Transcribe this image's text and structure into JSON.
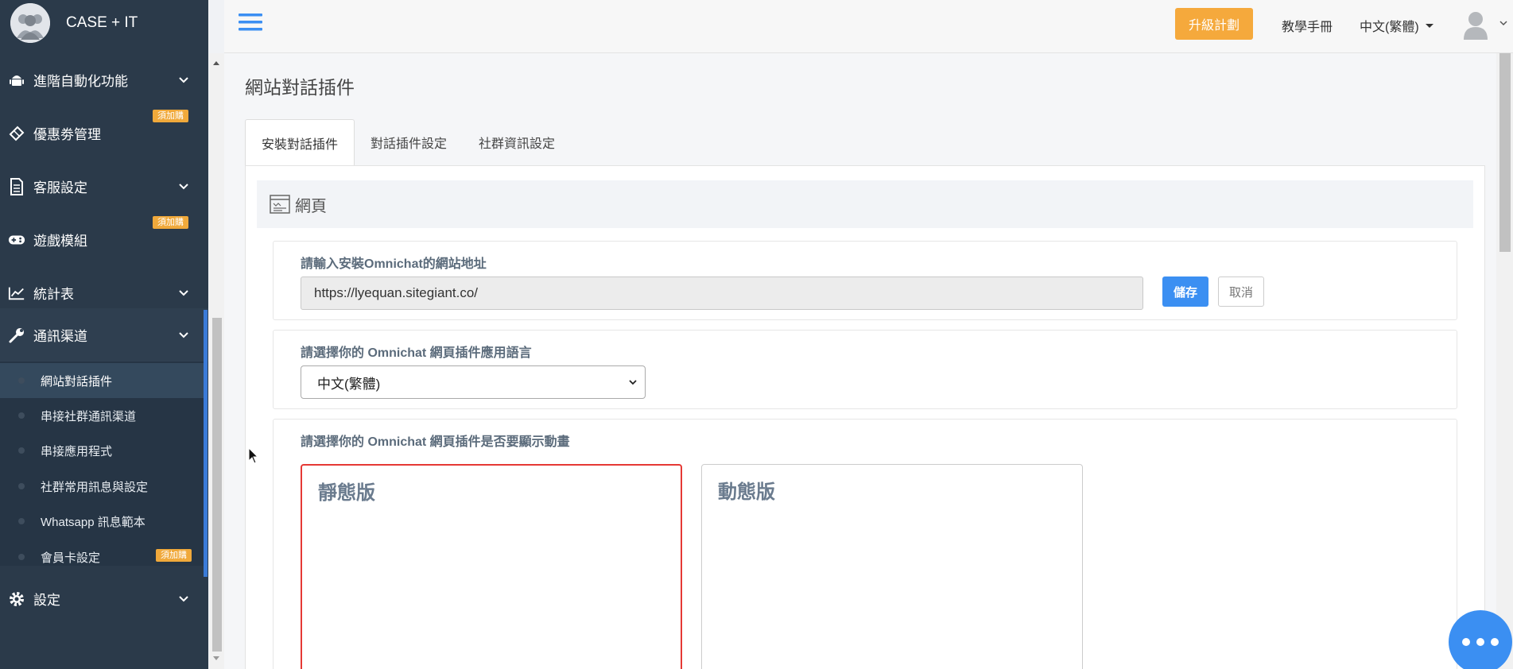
{
  "brand": "CASE + IT",
  "topbar": {
    "upgrade_label": "升級計劃",
    "manual_label": "教學手冊",
    "language_label": "中文(繁體)"
  },
  "sidebar": {
    "items": [
      {
        "label": "進階自動化功能",
        "icon": "android-icon",
        "chevron": true
      },
      {
        "label": "優惠劵管理",
        "icon": "ticket-icon",
        "badge": "須加購"
      },
      {
        "label": "客服設定",
        "icon": "document-icon",
        "chevron": true
      },
      {
        "label": "遊戲模組",
        "icon": "gamepad-icon",
        "badge": "須加購"
      },
      {
        "label": "統計表",
        "icon": "line-chart-icon",
        "chevron": true
      },
      {
        "label": "通訊渠道",
        "icon": "wrench-icon",
        "chevron": true
      },
      {
        "label": "設定",
        "icon": "gear-icon",
        "chevron": true
      }
    ],
    "sub_items": [
      {
        "label": "網站對話插件",
        "active": true
      },
      {
        "label": "串接社群通訊渠道"
      },
      {
        "label": "串接應用程式"
      },
      {
        "label": "社群常用訊息與設定"
      },
      {
        "label": "Whatsapp 訊息範本"
      },
      {
        "label": "會員卡設定",
        "badge": "須加購"
      }
    ]
  },
  "main": {
    "page_title": "網站對話插件",
    "tabs": [
      {
        "label": "安裝對話插件",
        "active": true
      },
      {
        "label": "對話插件設定"
      },
      {
        "label": "社群資訊設定"
      }
    ],
    "card_title": "網頁",
    "url_section": {
      "label": "請輸入安裝Omnichat的網站地址",
      "value": "https://lyequan.sitegiant.co/",
      "save_label": "儲存",
      "cancel_label": "取消"
    },
    "language_section": {
      "label": "請選擇你的 Omnichat 網頁插件應用語言",
      "selected": "中文(繁體)"
    },
    "animation_section": {
      "label": "請選擇你的 Omnichat 網頁插件是否要顯示動畫",
      "options": [
        {
          "label": "靜態版",
          "selected": true
        },
        {
          "label": "動態版",
          "selected": false
        }
      ]
    }
  },
  "colors": {
    "sidebar_bg": "#2b3a4a",
    "accent_blue": "#3b8ff2",
    "upgrade_orange": "#f5a93c",
    "selected_red": "#e53935"
  }
}
